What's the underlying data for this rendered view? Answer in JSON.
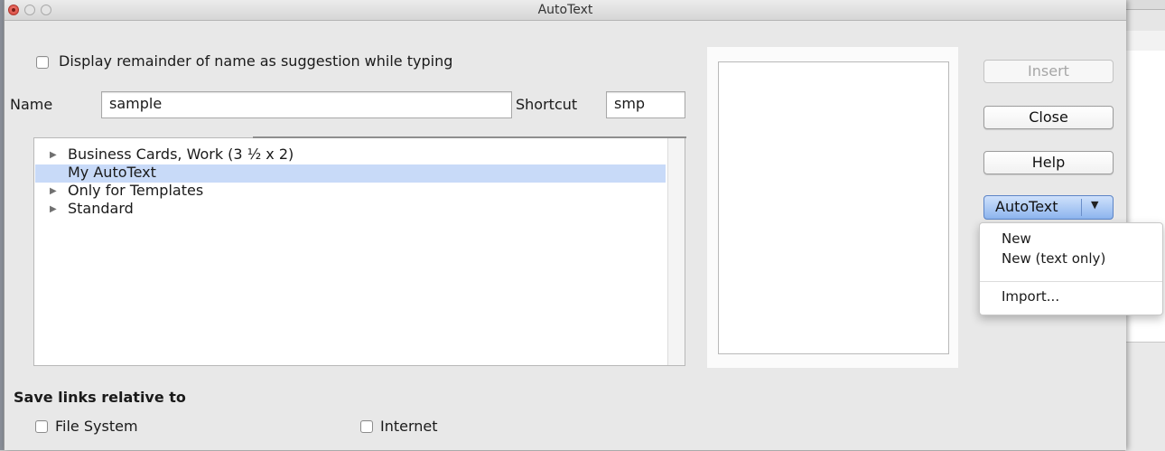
{
  "window": {
    "title": "AutoText"
  },
  "options": {
    "suggestion_label": "Display remainder of name as suggestion while typing"
  },
  "name_field": {
    "label": "Name",
    "value": "sample"
  },
  "shortcut_field": {
    "label": "Shortcut",
    "value": "smp"
  },
  "categories": [
    {
      "label": "Business Cards, Work (3 ½ x 2)",
      "expandable": true
    },
    {
      "label": "My AutoText",
      "expandable": false,
      "selected": true
    },
    {
      "label": "Only for Templates",
      "expandable": true
    },
    {
      "label": "Standard",
      "expandable": true
    }
  ],
  "buttons": {
    "insert": "Insert",
    "close": "Close",
    "help": "Help",
    "autotext": "AutoText"
  },
  "autotext_menu": {
    "items": [
      "New",
      "New (text only)",
      "Import..."
    ]
  },
  "save_links": {
    "title": "Save links relative to",
    "file_system": "File System",
    "internet": "Internet"
  },
  "colors": {
    "selection": "#c8daf8",
    "accent_button": "#8db5ee",
    "close_light": "#d24339"
  }
}
